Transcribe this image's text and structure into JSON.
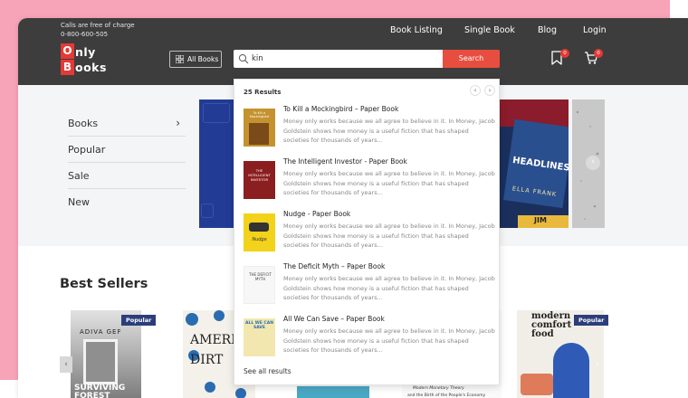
{
  "header": {
    "calls_text": "Calls are free of charge",
    "phone": "0-800-600-505",
    "logo_line1": "nly",
    "logo_line2": "ooks",
    "logo_letter1": "O",
    "logo_letter2": "B",
    "nav": [
      "Book Listing",
      "Single Book",
      "Blog",
      "Login"
    ],
    "all_books_label": "All Books",
    "search_value": "kin",
    "search_button": "Search",
    "wishlist_count": "0",
    "cart_count": "0"
  },
  "sidebar": {
    "items": [
      {
        "label": "Books",
        "has_arrow": true
      },
      {
        "label": "Popular"
      },
      {
        "label": "Sale"
      },
      {
        "label": "New"
      }
    ]
  },
  "best_sellers": {
    "title": "Best Sellers",
    "badge": "Popular",
    "book1_author": "ADIVA GEF",
    "book1_title": "SURVIVING FOREST",
    "book2_title": "AMERICA DIRT",
    "book3_line1": "Modern Monetary Theory",
    "book3_line2": "and the Birth of the People's Economy",
    "book4_title": "modern comfort food"
  },
  "banner": {
    "headline": "HEADLINES",
    "author": "ELLA FRANK",
    "tag": "JIM"
  },
  "search_results": {
    "count_label": "25 Results",
    "see_all": "See all results",
    "items": [
      {
        "title": "To Kill a Mockingbird – Paper Book",
        "cover_text": "To Kill a Mockingbird"
      },
      {
        "title": "The Intelligent Investor - Paper Book",
        "cover_text": "THE INTELLIGENT INVESTOR"
      },
      {
        "title": "Nudge - Paper Book",
        "cover_text": "Nudge"
      },
      {
        "title": "The Deficit Myth – Paper Book",
        "cover_text": "THE DEFICIT MYTH"
      },
      {
        "title": "All We Can Save – Paper Book",
        "cover_text": "ALL WE CAN SAVE"
      }
    ],
    "description": "Money only works because we all agree to believe in it. In Money, Jacob Goldstein shows how money is a useful fiction that has shaped societies for thousands of years..."
  },
  "colors": {
    "header_bg": "#3d3d3d",
    "accent_red": "#e84e3f",
    "badge_navy": "#2c3e7a",
    "page_pink": "#f7a3b8"
  }
}
